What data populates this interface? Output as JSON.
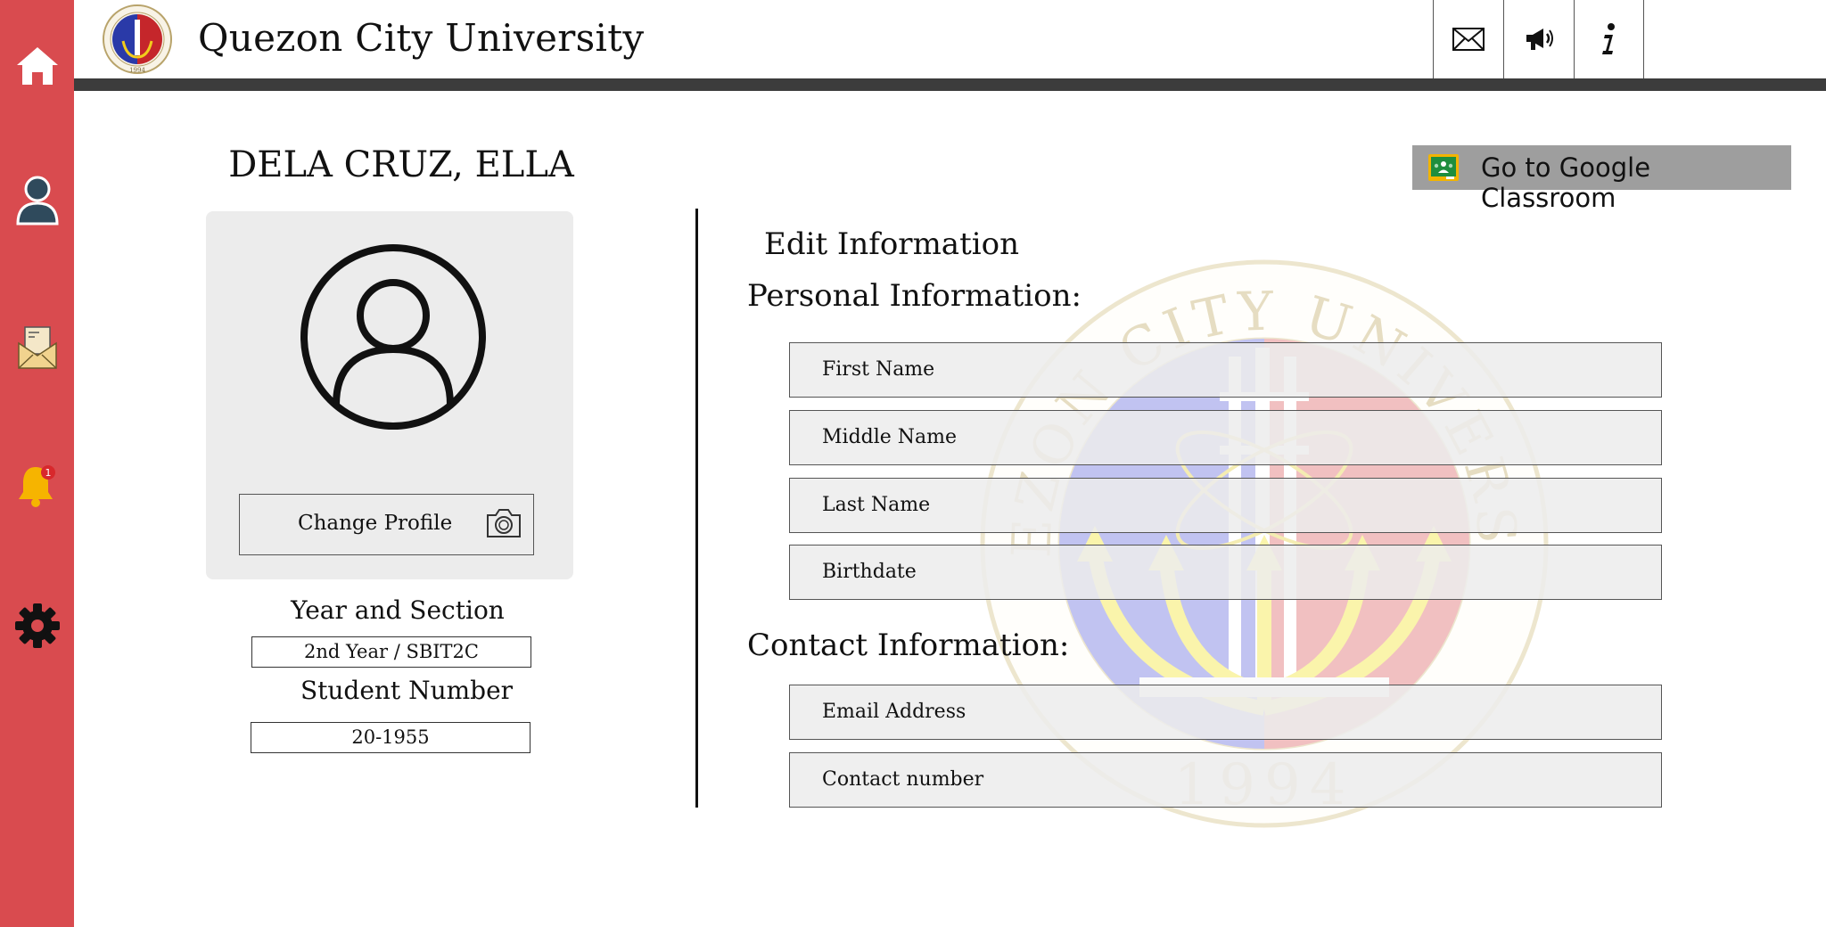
{
  "app": {
    "title": "Quezon City University"
  },
  "logo": {
    "text_top": "QUEZON CITY UNIVERSITY",
    "year": "1994"
  },
  "sidebar": {
    "items": [
      {
        "name": "home",
        "icon": "home-icon"
      },
      {
        "name": "profile",
        "icon": "user-icon"
      },
      {
        "name": "messages",
        "icon": "envelope-letter-icon"
      },
      {
        "name": "notifications",
        "icon": "bell-icon",
        "badge": "1"
      },
      {
        "name": "settings",
        "icon": "gear-icon"
      }
    ]
  },
  "topbar": {
    "items": [
      {
        "name": "mail",
        "icon": "mail-icon"
      },
      {
        "name": "announcements",
        "icon": "megaphone-icon"
      },
      {
        "name": "info",
        "icon": "info-icon"
      }
    ]
  },
  "student": {
    "name": "DELA CRUZ, ELLA",
    "change_profile_label": "Change Profile",
    "year_section_label": "Year and Section",
    "year_section_value": "2nd Year / SBIT2C",
    "student_number_label": "Student Number",
    "student_number_value": "20-1955"
  },
  "classroom_button": {
    "label": "Go to Google Classroom"
  },
  "form": {
    "title": "Edit Information",
    "personal_title": "Personal Information:",
    "personal_fields": [
      "First Name",
      "Middle Name",
      "Last Name",
      "Birthdate"
    ],
    "contact_title": "Contact Information:",
    "contact_fields": [
      "Email Address",
      "Contact number"
    ]
  },
  "watermark": {
    "text": "QUEZON CITY UNIVERSITY",
    "year": "1994"
  },
  "colors": {
    "sidebar": "#d94b4f",
    "header_bar": "#3c3c3c",
    "card": "#ececec",
    "classroom_button": "#9e9e9e",
    "bell": "#f6b400"
  }
}
